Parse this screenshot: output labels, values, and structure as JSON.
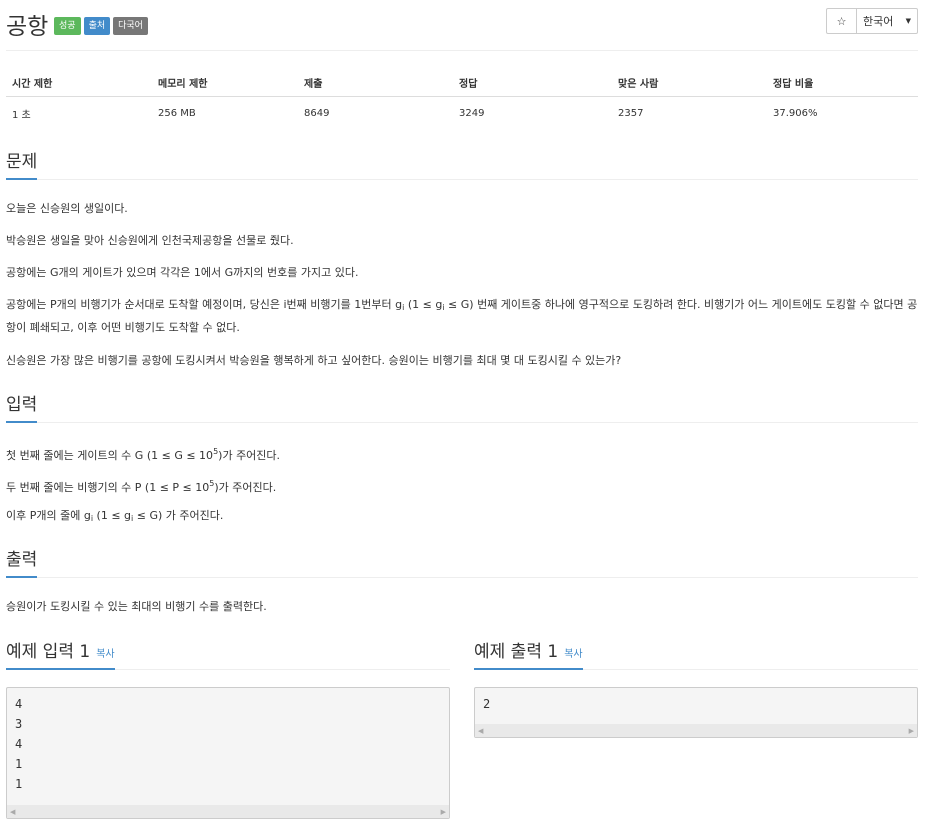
{
  "problem": {
    "title": "공항",
    "badges": [
      "성공",
      "출처",
      "다국어"
    ],
    "star_icon": "☆",
    "language": "한국어"
  },
  "info_table": {
    "headers": [
      "시간 제한",
      "메모리 제한",
      "제출",
      "정답",
      "맞은 사람",
      "정답 비율"
    ],
    "values": [
      "1 초",
      "256 MB",
      "8649",
      "3249",
      "2357",
      "37.906%"
    ]
  },
  "sections": {
    "problem_title": "문제",
    "input_title": "입력",
    "output_title": "출력"
  },
  "statement": {
    "p1": "오늘은 신승원의 생일이다.",
    "p2": "박승원은 생일을 맞아 신승원에게 인천국제공항을 선물로 줬다.",
    "p3": "공항에는 G개의 게이트가 있으며 각각은 1에서 G까지의 번호를 가지고 있다.",
    "p4a": "공항에는 P개의 비행기가 순서대로 도착할 예정이며, 당신은 i번째 비행기를 1번부터 g",
    "p4b": " (1 ≤ g",
    "p4c": " ≤ G) 번째 게이트중 하나에 영구적으로 도킹하려 한다. 비행기가 어느 게이트에도 도킹할 수 없다면 공항이 폐쇄되고, 이후 어떤 비행기도 도착할 수 없다.",
    "p5": "신승원은 가장 많은 비행기를 공항에 도킹시켜서 박승원을 행복하게 하고 싶어한다. 승원이는 비행기를 최대 몇 대 도킹시킬 수 있는가?",
    "sub_i": "i"
  },
  "input": {
    "l1a": "첫 번째 줄에는 게이트의 수 G (1 ≤ G ≤ 10",
    "l1b": ")가 주어진다.",
    "l2a": "두 번째 줄에는 비행기의 수 P (1 ≤ P ≤ 10",
    "l2b": ")가 주어진다.",
    "sup5": "5",
    "l3a": "이후 P개의 줄에 g",
    "l3b": " (1 ≤ g",
    "l3c": " ≤ G) 가 주어진다."
  },
  "output": {
    "text": "승원이가 도킹시킬 수 있는 최대의 비행기 수를 출력한다."
  },
  "examples": {
    "input_title": "예제 입력 1",
    "output_title": "예제 출력 1",
    "copy_label": "복사",
    "input_text": "4\n3\n4\n1\n1",
    "output_text": "2"
  }
}
